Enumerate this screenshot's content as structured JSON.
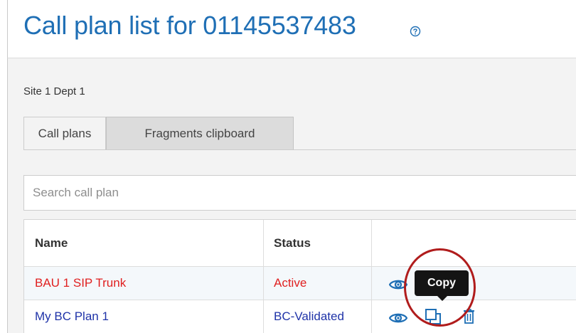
{
  "header": {
    "title": "Call plan list for 01145537483",
    "help_icon": "help-circle-icon"
  },
  "breadcrumb": "Site 1 Dept 1",
  "tabs": [
    {
      "label": "Call plans",
      "active": true
    },
    {
      "label": "Fragments clipboard",
      "active": false
    }
  ],
  "search": {
    "placeholder": "Search call plan",
    "value": ""
  },
  "table": {
    "columns": [
      "Name",
      "Status",
      ""
    ],
    "rows": [
      {
        "name": "BAU 1 SIP Trunk",
        "status": "Active",
        "color": "#e02020"
      },
      {
        "name": "My BC Plan 1",
        "status": "BC-Validated",
        "color": "#1f33a8"
      }
    ],
    "action_icons": [
      "eye-icon",
      "copy-icon",
      "trash-icon"
    ]
  },
  "tooltip": {
    "text": "Copy"
  },
  "colors": {
    "title": "#1f6fb5",
    "active_status": "#e02020",
    "validated_status": "#1f33a8",
    "highlight": "#b01c1c"
  }
}
